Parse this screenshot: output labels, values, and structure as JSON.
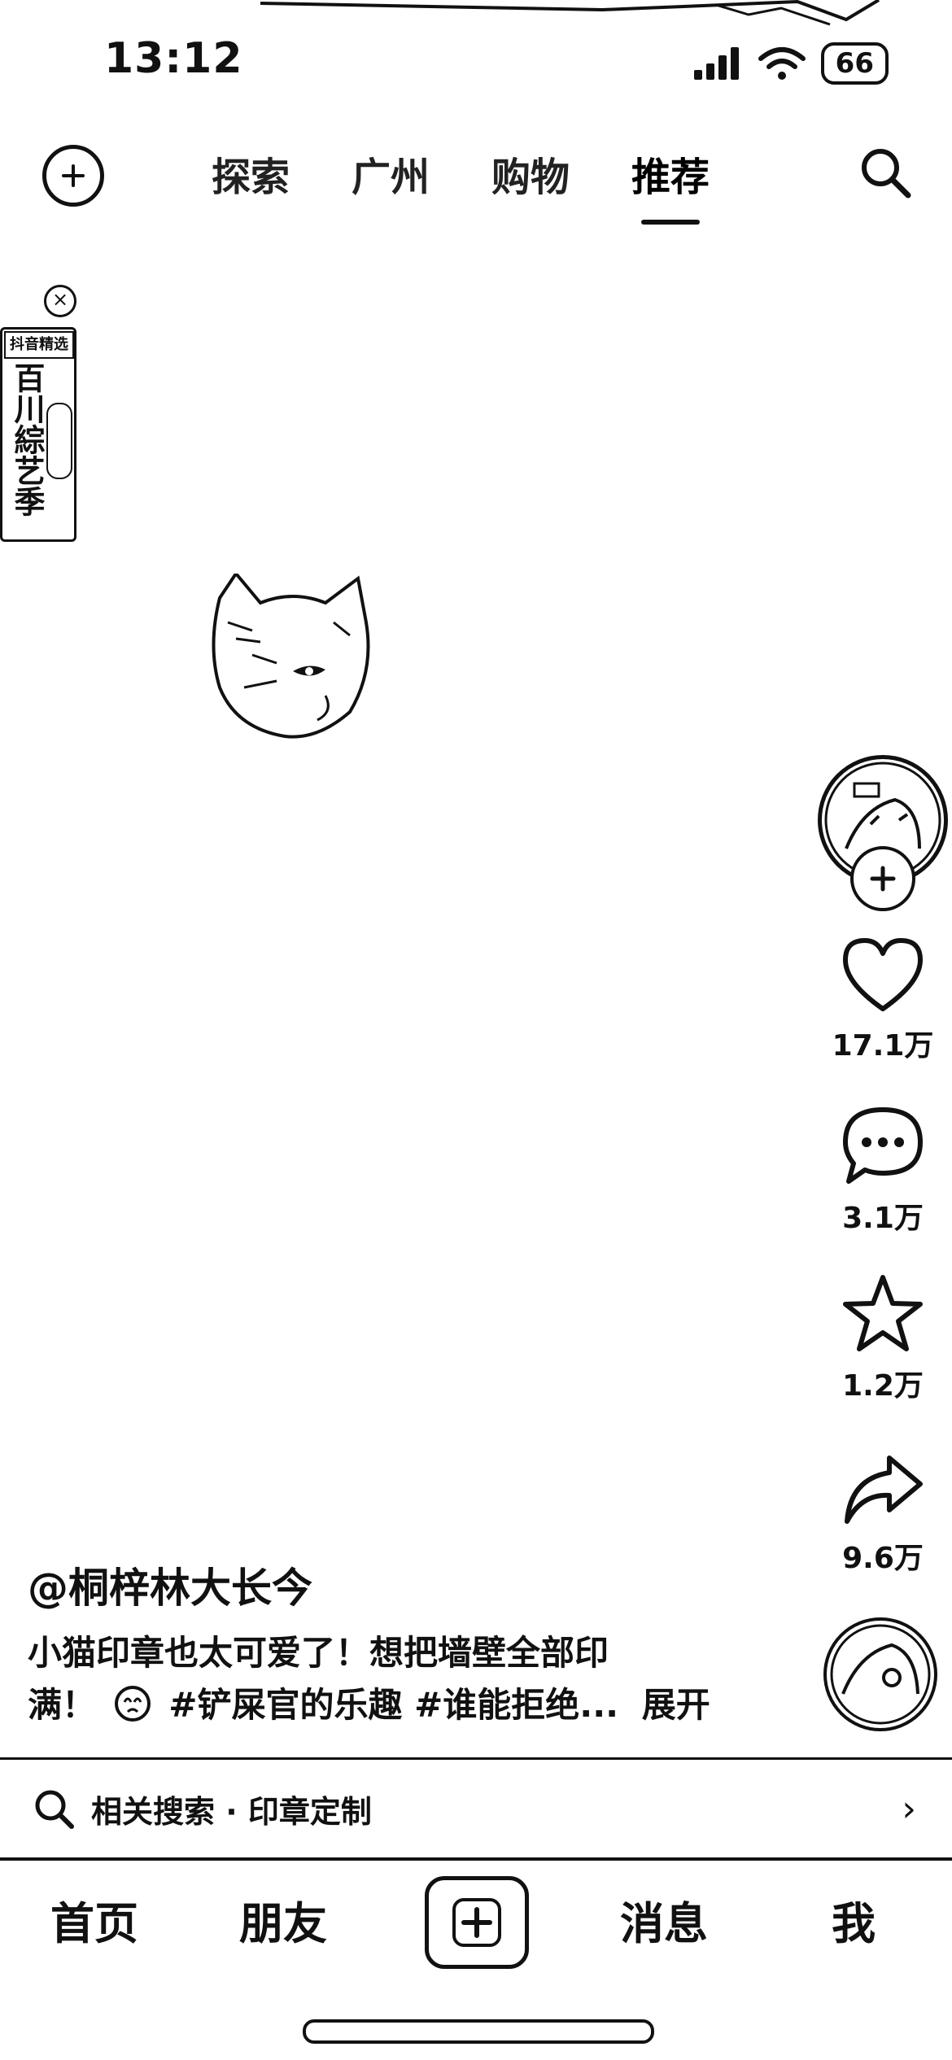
{
  "status_bar": {
    "time": "13:12",
    "battery": "66"
  },
  "top_nav": {
    "tabs": [
      {
        "label": "探索",
        "active": false
      },
      {
        "label": "广州",
        "active": false
      },
      {
        "label": "购物",
        "active": false
      },
      {
        "label": "推荐",
        "active": true
      }
    ]
  },
  "promo_badge": {
    "top_label": "抖音精选",
    "title": "百川綜艺季"
  },
  "rail": {
    "like_count": "17.1万",
    "comment_count": "3.1万",
    "favorite_count": "1.2万",
    "share_count": "9.6万"
  },
  "post": {
    "author": "@桐梓林大长今",
    "caption_line1": "小猫印章也太可爱了！想把墙壁全部印",
    "caption_line2": "满！",
    "hashtags": "#铲屎官的乐趣 #谁能拒绝...",
    "expand_label": "展开"
  },
  "related_search": {
    "label": "相关搜索 · 印章定制"
  },
  "tabbar": {
    "items": [
      {
        "label": "首页"
      },
      {
        "label": "朋友"
      },
      {
        "label": "消息"
      },
      {
        "label": "我"
      }
    ]
  }
}
